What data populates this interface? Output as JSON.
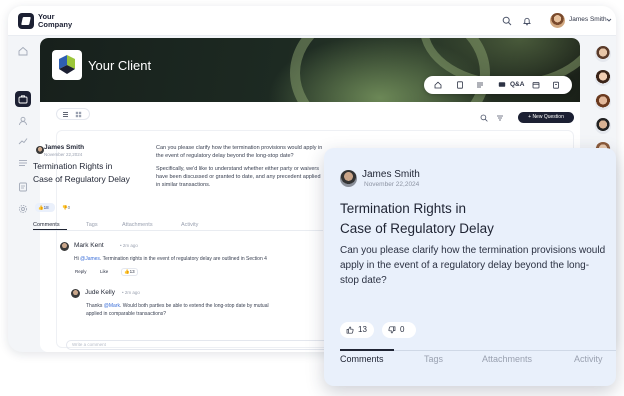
{
  "topbar": {
    "company_line1": "Your",
    "company_line2": "Company",
    "user_name": "James Smith",
    "icons": [
      "search-icon",
      "bell-icon",
      "chevron-down-icon"
    ]
  },
  "banner": {
    "client_name": "Your Client",
    "toolbar_label": "Q&A"
  },
  "actions": {
    "new_question": "+ New Question"
  },
  "question": {
    "author": "James Smith",
    "date": "November 22,2024",
    "title_line1": "Termination Rights in",
    "title_line2": "Case of Regulatory Delay",
    "body_p1": "Can you please clarify how the termination provisions would apply in the event of regulatory delay beyond the long-stop date?",
    "body_p2": "Specifically, we'd like to understand whether either party or waivers have been discussed or granted to date, and any precedent applied in similar transactions.",
    "likes": "18",
    "dislikes": "0",
    "tabs": [
      "Comments",
      "Tags",
      "Attachments",
      "Activity"
    ]
  },
  "comments": [
    {
      "author": "Mark Kent",
      "time": "• 2m ago",
      "mention": "@James",
      "text": "Hi @James. Termination rights in the event of regulatory delay are outlined in Section 4",
      "reply": "Reply",
      "like": "Like",
      "likes": "13"
    },
    {
      "author": "Jude Kelly",
      "time": "• 2m ago",
      "text_line1": "Thanks @Mark. Would both parties be able to extend the long-stop date by mutual",
      "text_line2": "applied in comparable transactions?"
    }
  ],
  "comment_box": {
    "placeholder": "Write a comment"
  },
  "popup": {
    "author": "James Smith",
    "date": "November 22,2024",
    "title_line1": "Termination Rights in",
    "title_line2": "Case of Regulatory Delay",
    "body": "Can you please clarify how the termination provisions would apply in the event of a regulatory delay beyond the long-stop date?",
    "likes": "13",
    "dislikes": "0",
    "tabs": [
      "Comments",
      "Tags",
      "Attachments",
      "Activity"
    ]
  },
  "colors": {
    "accent_dark": "#1c2033",
    "popup_bg": "#e9f0fb",
    "mention": "#3b6fd9"
  }
}
